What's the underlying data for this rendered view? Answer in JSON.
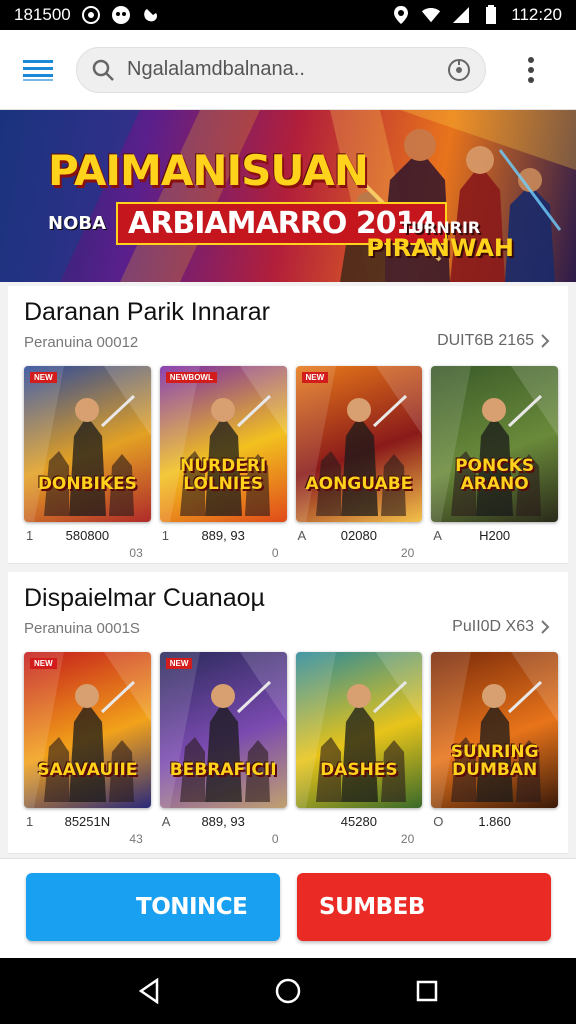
{
  "status_bar": {
    "left_text": "181500",
    "time": "112:20"
  },
  "app_bar": {
    "search_text": "Ngalalamdbalnana..",
    "icons": [
      "menu-icon",
      "search-icon",
      "filter-icon",
      "more-vert-icon"
    ]
  },
  "banner": {
    "title": "PAIMANISUAN",
    "sub_small": "NOBA",
    "sub": "ARBIAMARRO 2014",
    "right_small": "TURNRIR",
    "right": "PIRANWAH"
  },
  "sections": [
    {
      "title": "Daranan Parik Innarar",
      "subtitle": "Peranuina 00012",
      "more": "DUIT6B 2165",
      "cards": [
        {
          "badge": "NEW",
          "title": "DONBIKES",
          "left": "1",
          "value": "580800",
          "sub": "03",
          "colors": [
            "#2d4a9a",
            "#e3a124",
            "#b02a2a"
          ]
        },
        {
          "badge": "NEWBOWL",
          "title": "NURDERI LOLNIES",
          "left": "1",
          "value": "889, 93",
          "sub": "0",
          "colors": [
            "#7a2aa8",
            "#f2c11f",
            "#e04a1a"
          ]
        },
        {
          "badge": "NEW",
          "title": "AONGUABE",
          "left": "A",
          "value": "02080",
          "sub": "20",
          "colors": [
            "#e87a1a",
            "#8a1a1a",
            "#f4c24a"
          ]
        },
        {
          "badge": "",
          "title": "PONCKS ARANO",
          "left": "A",
          "value": "H200",
          "sub": "",
          "colors": [
            "#3a5a2a",
            "#6a8a3a",
            "#2a2a1a"
          ]
        }
      ]
    },
    {
      "title": "Dispaielmar Cuanaoµ",
      "subtitle": "Peranuina 0001S",
      "more": "PuII0D X63",
      "cards": [
        {
          "badge": "NEW",
          "title": "SAAVAUIIE",
          "left": "1",
          "value": "85251N",
          "sub": "43",
          "colors": [
            "#c41c1c",
            "#f2a21a",
            "#2a2a7a"
          ]
        },
        {
          "badge": "NEW",
          "title": "BEBRAFICII",
          "left": "A",
          "value": "889, 93",
          "sub": "0",
          "colors": [
            "#2a2a5a",
            "#7a4ab0",
            "#c0a070"
          ]
        },
        {
          "badge": "",
          "title": "DASHES",
          "left": "",
          "value": "45280",
          "sub": "20",
          "colors": [
            "#2a8a9a",
            "#e8c41a",
            "#3a6a2a"
          ]
        },
        {
          "badge": "",
          "title": "SUNRING DUMBAN",
          "left": "O",
          "value": "1.860",
          "sub": "",
          "colors": [
            "#7a2a0a",
            "#e8741a",
            "#3a1a0a"
          ]
        }
      ]
    }
  ],
  "actions": {
    "primary": "TONINCE",
    "danger": "SUMBEB"
  },
  "nav": [
    "back-icon",
    "home-icon",
    "recents-icon"
  ],
  "colors": {
    "primary": "#1aa0f0",
    "danger": "#ea2a24",
    "accent_blue": "#1a8ad8"
  }
}
